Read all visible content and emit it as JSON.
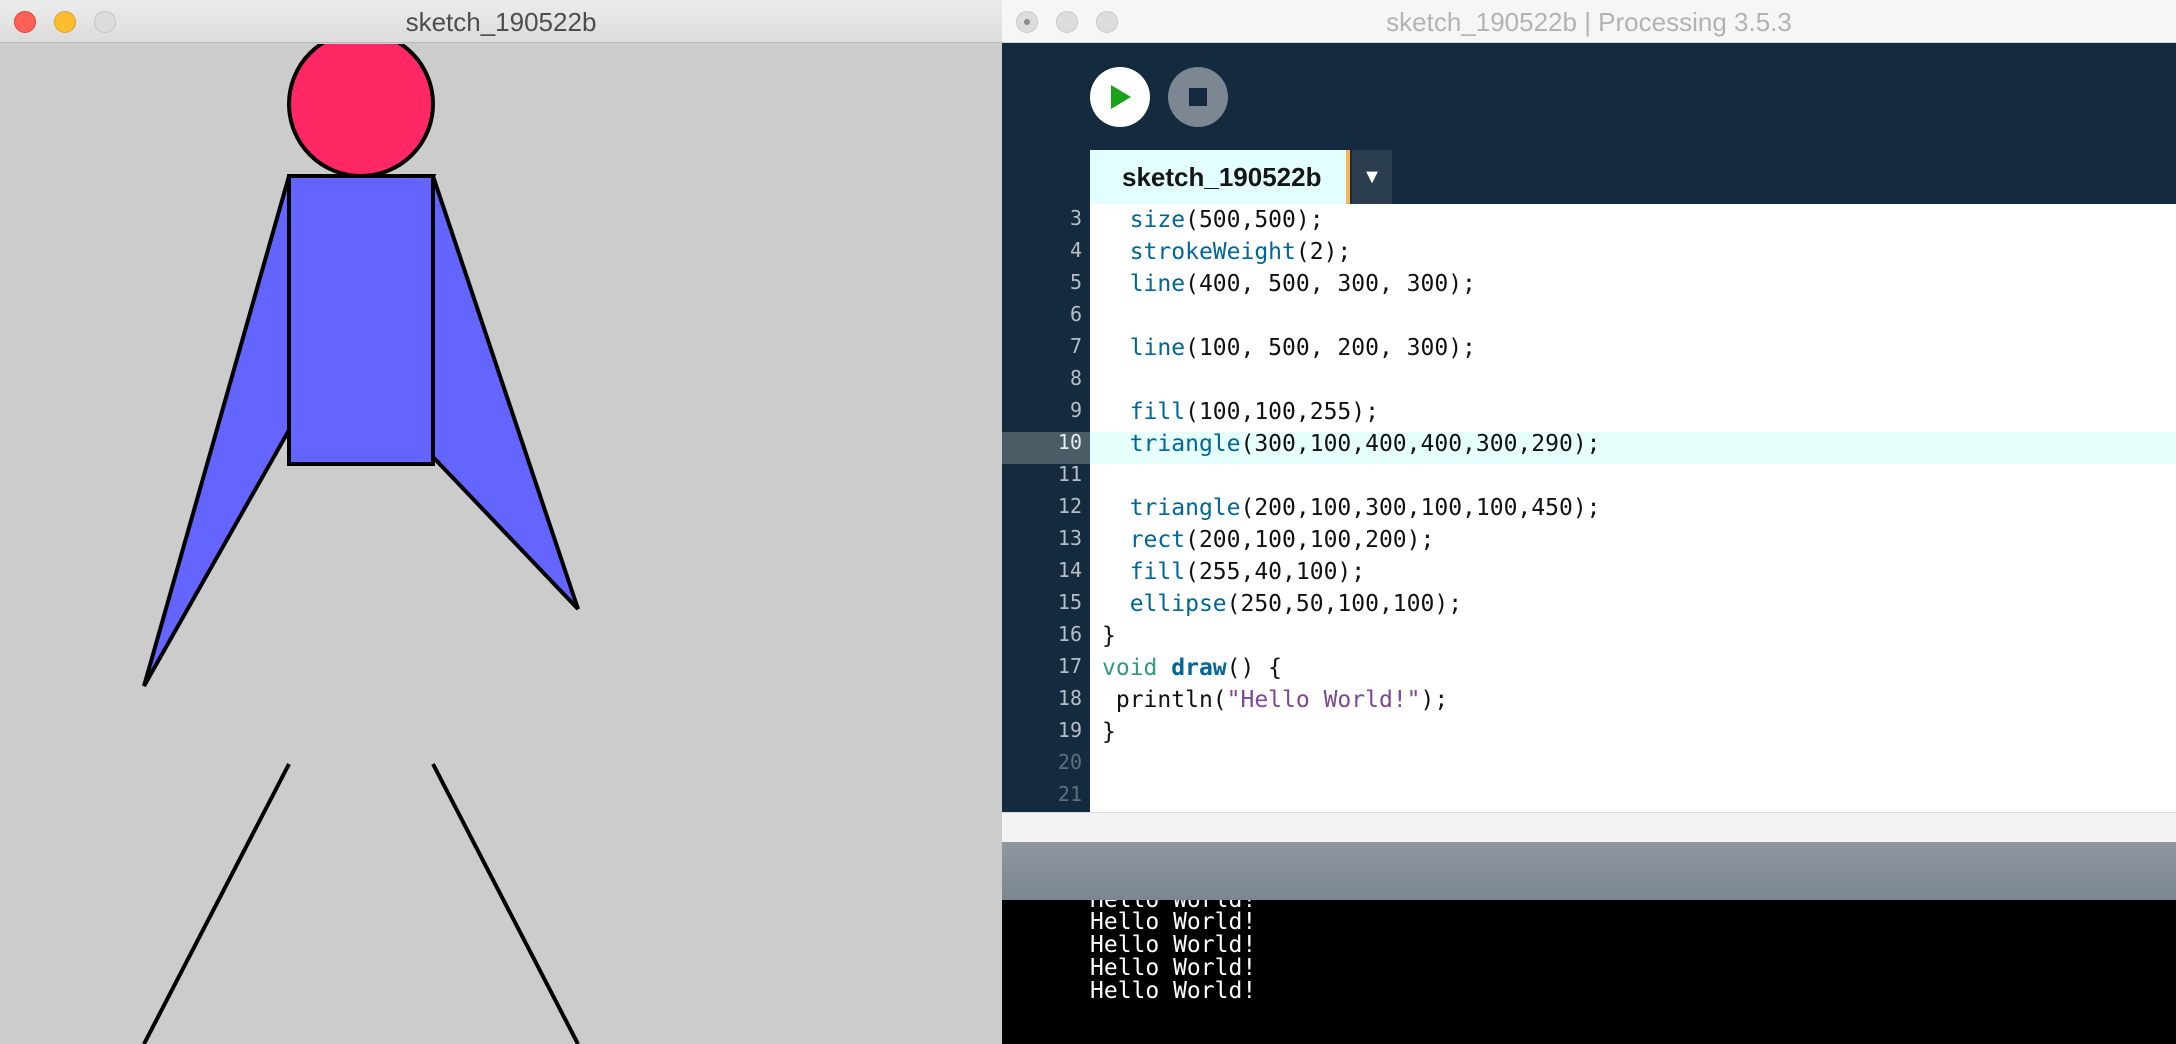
{
  "sketch_window": {
    "title": "sketch_190522b",
    "background_color": "#cccccc"
  },
  "ide_window": {
    "title": "sketch_190522b | Processing 3.5.3"
  },
  "toolbar": {
    "run_icon": "play-icon",
    "stop_icon": "stop-icon"
  },
  "tabs": [
    {
      "label": "sketch_190522b",
      "active": true
    }
  ],
  "tab_menu_icon": "▼",
  "editor": {
    "current_line": 10,
    "line_numbers": [
      "3",
      "4",
      "5",
      "6",
      "7",
      "8",
      "9",
      "10",
      "11",
      "12",
      "13",
      "14",
      "15",
      "16",
      "17",
      "18",
      "19",
      "20",
      "21"
    ],
    "lines": [
      {
        "fn": "size",
        "args": "(500,500);"
      },
      {
        "fn": "strokeWeight",
        "args": "(2);"
      },
      {
        "fn": "line",
        "args": "(400, 500, 300, 300);"
      },
      {
        "fn": "",
        "args": ""
      },
      {
        "fn": "line",
        "args": "(100, 500, 200, 300);"
      },
      {
        "fn": "",
        "args": ""
      },
      {
        "fn": "fill",
        "args": "(100,100,255);"
      },
      {
        "fn": "triangle",
        "args": "(300,100,400,400,300,290);"
      },
      {
        "fn": "",
        "args": ""
      },
      {
        "fn": "triangle",
        "args": "(200,100,300,100,100,450);"
      },
      {
        "fn": "rect",
        "args": "(200,100,100,200);"
      },
      {
        "fn": "fill",
        "args": "(255,40,100);"
      },
      {
        "fn": "ellipse",
        "args": "(250,50,100,100);"
      },
      {
        "text": "}"
      },
      {
        "keyword": "void",
        "name": "draw",
        "rest": "() {"
      },
      {
        "fn": "println",
        "open": "(",
        "string": "\"Hello World!\"",
        "close": ");"
      },
      {
        "text": "}"
      }
    ]
  },
  "console": {
    "lines": [
      "Hello World!",
      "Hello World!",
      "Hello World!",
      "Hello World!",
      "Hello World!"
    ]
  },
  "colors": {
    "accent_tab_border": "#f7b55c",
    "editor_header_bg": "#142a3e",
    "function_color": "#006699",
    "keyword_color": "#33997e",
    "string_color": "#7d4793",
    "figure_blue": "#6464ff",
    "figure_pink": "#ff2864"
  }
}
